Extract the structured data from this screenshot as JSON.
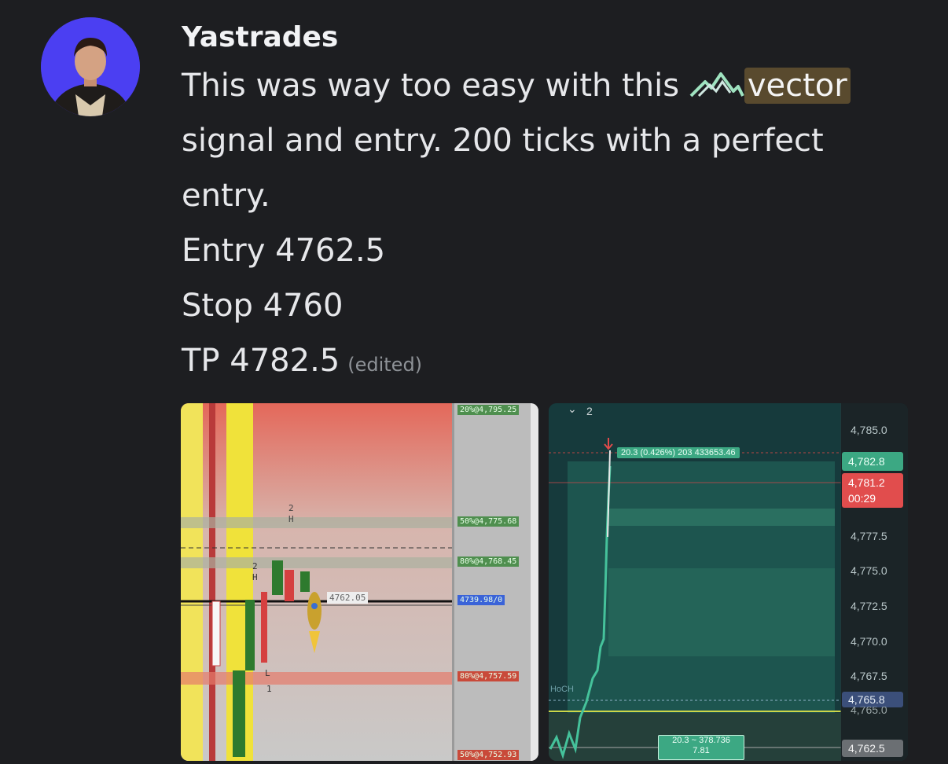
{
  "message": {
    "username": "Yastrades",
    "lines": [
      "This was way too easy with this",
      "signal and entry. 200 ticks with a perfect",
      "entry.",
      "Entry 4762.5",
      "Stop 4760",
      "TP 4782.5"
    ],
    "mention": "vector",
    "edited": "(edited)",
    "emoji_icon": "mountain-icon",
    "mention_color": "#594a2e"
  },
  "attachment_left": {
    "labels": [
      "20%@4,795.25",
      "50%@4,775.68",
      "80%@4,768.45",
      "4739.98/0",
      "80%@4,757.59",
      "50%@4,752.93"
    ],
    "chart_text": [
      "2",
      "H",
      "2",
      "H",
      "L",
      "1",
      "4762.05"
    ],
    "icon": "rocket-icon"
  },
  "attachment_right": {
    "collapse_label": "2",
    "chevron_icon": "chevron-down-icon",
    "axis": [
      "4,785.0",
      "4,777.5",
      "4,775.0",
      "4,772.5",
      "4,770.0",
      "4,767.5"
    ],
    "price_tp": "4,782.8",
    "price_current": "4,781.2",
    "countdown": "00:29",
    "price_stop": "4,765.8",
    "price_stop_under": "4,765.0",
    "price_entry": "4,762.5",
    "tooltip": "20.3 (0.426%) 203 433653.46",
    "bottom_box_1": "20.3 ~ 378.736",
    "bottom_box_2": "7.81",
    "side_label": "HoCH",
    "colors": {
      "up": "#3ca883",
      "down": "#e04b4b",
      "panel": "#16373a"
    }
  }
}
